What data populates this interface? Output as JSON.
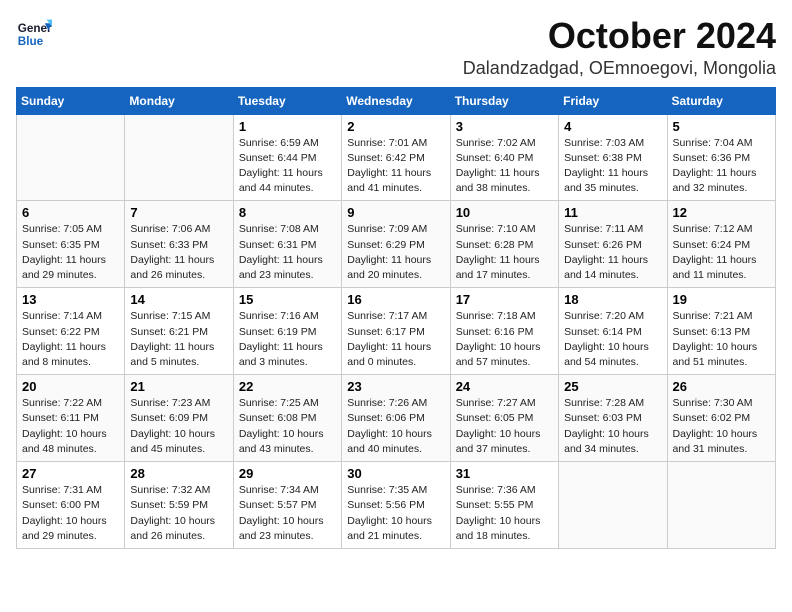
{
  "header": {
    "logo_line1": "General",
    "logo_line2": "Blue",
    "month": "October 2024",
    "location": "Dalandzadgad, OEmnoegovi, Mongolia"
  },
  "days_of_week": [
    "Sunday",
    "Monday",
    "Tuesday",
    "Wednesday",
    "Thursday",
    "Friday",
    "Saturday"
  ],
  "weeks": [
    [
      {
        "day": "",
        "info": ""
      },
      {
        "day": "",
        "info": ""
      },
      {
        "day": "1",
        "info": "Sunrise: 6:59 AM\nSunset: 6:44 PM\nDaylight: 11 hours and 44 minutes."
      },
      {
        "day": "2",
        "info": "Sunrise: 7:01 AM\nSunset: 6:42 PM\nDaylight: 11 hours and 41 minutes."
      },
      {
        "day": "3",
        "info": "Sunrise: 7:02 AM\nSunset: 6:40 PM\nDaylight: 11 hours and 38 minutes."
      },
      {
        "day": "4",
        "info": "Sunrise: 7:03 AM\nSunset: 6:38 PM\nDaylight: 11 hours and 35 minutes."
      },
      {
        "day": "5",
        "info": "Sunrise: 7:04 AM\nSunset: 6:36 PM\nDaylight: 11 hours and 32 minutes."
      }
    ],
    [
      {
        "day": "6",
        "info": "Sunrise: 7:05 AM\nSunset: 6:35 PM\nDaylight: 11 hours and 29 minutes."
      },
      {
        "day": "7",
        "info": "Sunrise: 7:06 AM\nSunset: 6:33 PM\nDaylight: 11 hours and 26 minutes."
      },
      {
        "day": "8",
        "info": "Sunrise: 7:08 AM\nSunset: 6:31 PM\nDaylight: 11 hours and 23 minutes."
      },
      {
        "day": "9",
        "info": "Sunrise: 7:09 AM\nSunset: 6:29 PM\nDaylight: 11 hours and 20 minutes."
      },
      {
        "day": "10",
        "info": "Sunrise: 7:10 AM\nSunset: 6:28 PM\nDaylight: 11 hours and 17 minutes."
      },
      {
        "day": "11",
        "info": "Sunrise: 7:11 AM\nSunset: 6:26 PM\nDaylight: 11 hours and 14 minutes."
      },
      {
        "day": "12",
        "info": "Sunrise: 7:12 AM\nSunset: 6:24 PM\nDaylight: 11 hours and 11 minutes."
      }
    ],
    [
      {
        "day": "13",
        "info": "Sunrise: 7:14 AM\nSunset: 6:22 PM\nDaylight: 11 hours and 8 minutes."
      },
      {
        "day": "14",
        "info": "Sunrise: 7:15 AM\nSunset: 6:21 PM\nDaylight: 11 hours and 5 minutes."
      },
      {
        "day": "15",
        "info": "Sunrise: 7:16 AM\nSunset: 6:19 PM\nDaylight: 11 hours and 3 minutes."
      },
      {
        "day": "16",
        "info": "Sunrise: 7:17 AM\nSunset: 6:17 PM\nDaylight: 11 hours and 0 minutes."
      },
      {
        "day": "17",
        "info": "Sunrise: 7:18 AM\nSunset: 6:16 PM\nDaylight: 10 hours and 57 minutes."
      },
      {
        "day": "18",
        "info": "Sunrise: 7:20 AM\nSunset: 6:14 PM\nDaylight: 10 hours and 54 minutes."
      },
      {
        "day": "19",
        "info": "Sunrise: 7:21 AM\nSunset: 6:13 PM\nDaylight: 10 hours and 51 minutes."
      }
    ],
    [
      {
        "day": "20",
        "info": "Sunrise: 7:22 AM\nSunset: 6:11 PM\nDaylight: 10 hours and 48 minutes."
      },
      {
        "day": "21",
        "info": "Sunrise: 7:23 AM\nSunset: 6:09 PM\nDaylight: 10 hours and 45 minutes."
      },
      {
        "day": "22",
        "info": "Sunrise: 7:25 AM\nSunset: 6:08 PM\nDaylight: 10 hours and 43 minutes."
      },
      {
        "day": "23",
        "info": "Sunrise: 7:26 AM\nSunset: 6:06 PM\nDaylight: 10 hours and 40 minutes."
      },
      {
        "day": "24",
        "info": "Sunrise: 7:27 AM\nSunset: 6:05 PM\nDaylight: 10 hours and 37 minutes."
      },
      {
        "day": "25",
        "info": "Sunrise: 7:28 AM\nSunset: 6:03 PM\nDaylight: 10 hours and 34 minutes."
      },
      {
        "day": "26",
        "info": "Sunrise: 7:30 AM\nSunset: 6:02 PM\nDaylight: 10 hours and 31 minutes."
      }
    ],
    [
      {
        "day": "27",
        "info": "Sunrise: 7:31 AM\nSunset: 6:00 PM\nDaylight: 10 hours and 29 minutes."
      },
      {
        "day": "28",
        "info": "Sunrise: 7:32 AM\nSunset: 5:59 PM\nDaylight: 10 hours and 26 minutes."
      },
      {
        "day": "29",
        "info": "Sunrise: 7:34 AM\nSunset: 5:57 PM\nDaylight: 10 hours and 23 minutes."
      },
      {
        "day": "30",
        "info": "Sunrise: 7:35 AM\nSunset: 5:56 PM\nDaylight: 10 hours and 21 minutes."
      },
      {
        "day": "31",
        "info": "Sunrise: 7:36 AM\nSunset: 5:55 PM\nDaylight: 10 hours and 18 minutes."
      },
      {
        "day": "",
        "info": ""
      },
      {
        "day": "",
        "info": ""
      }
    ]
  ]
}
